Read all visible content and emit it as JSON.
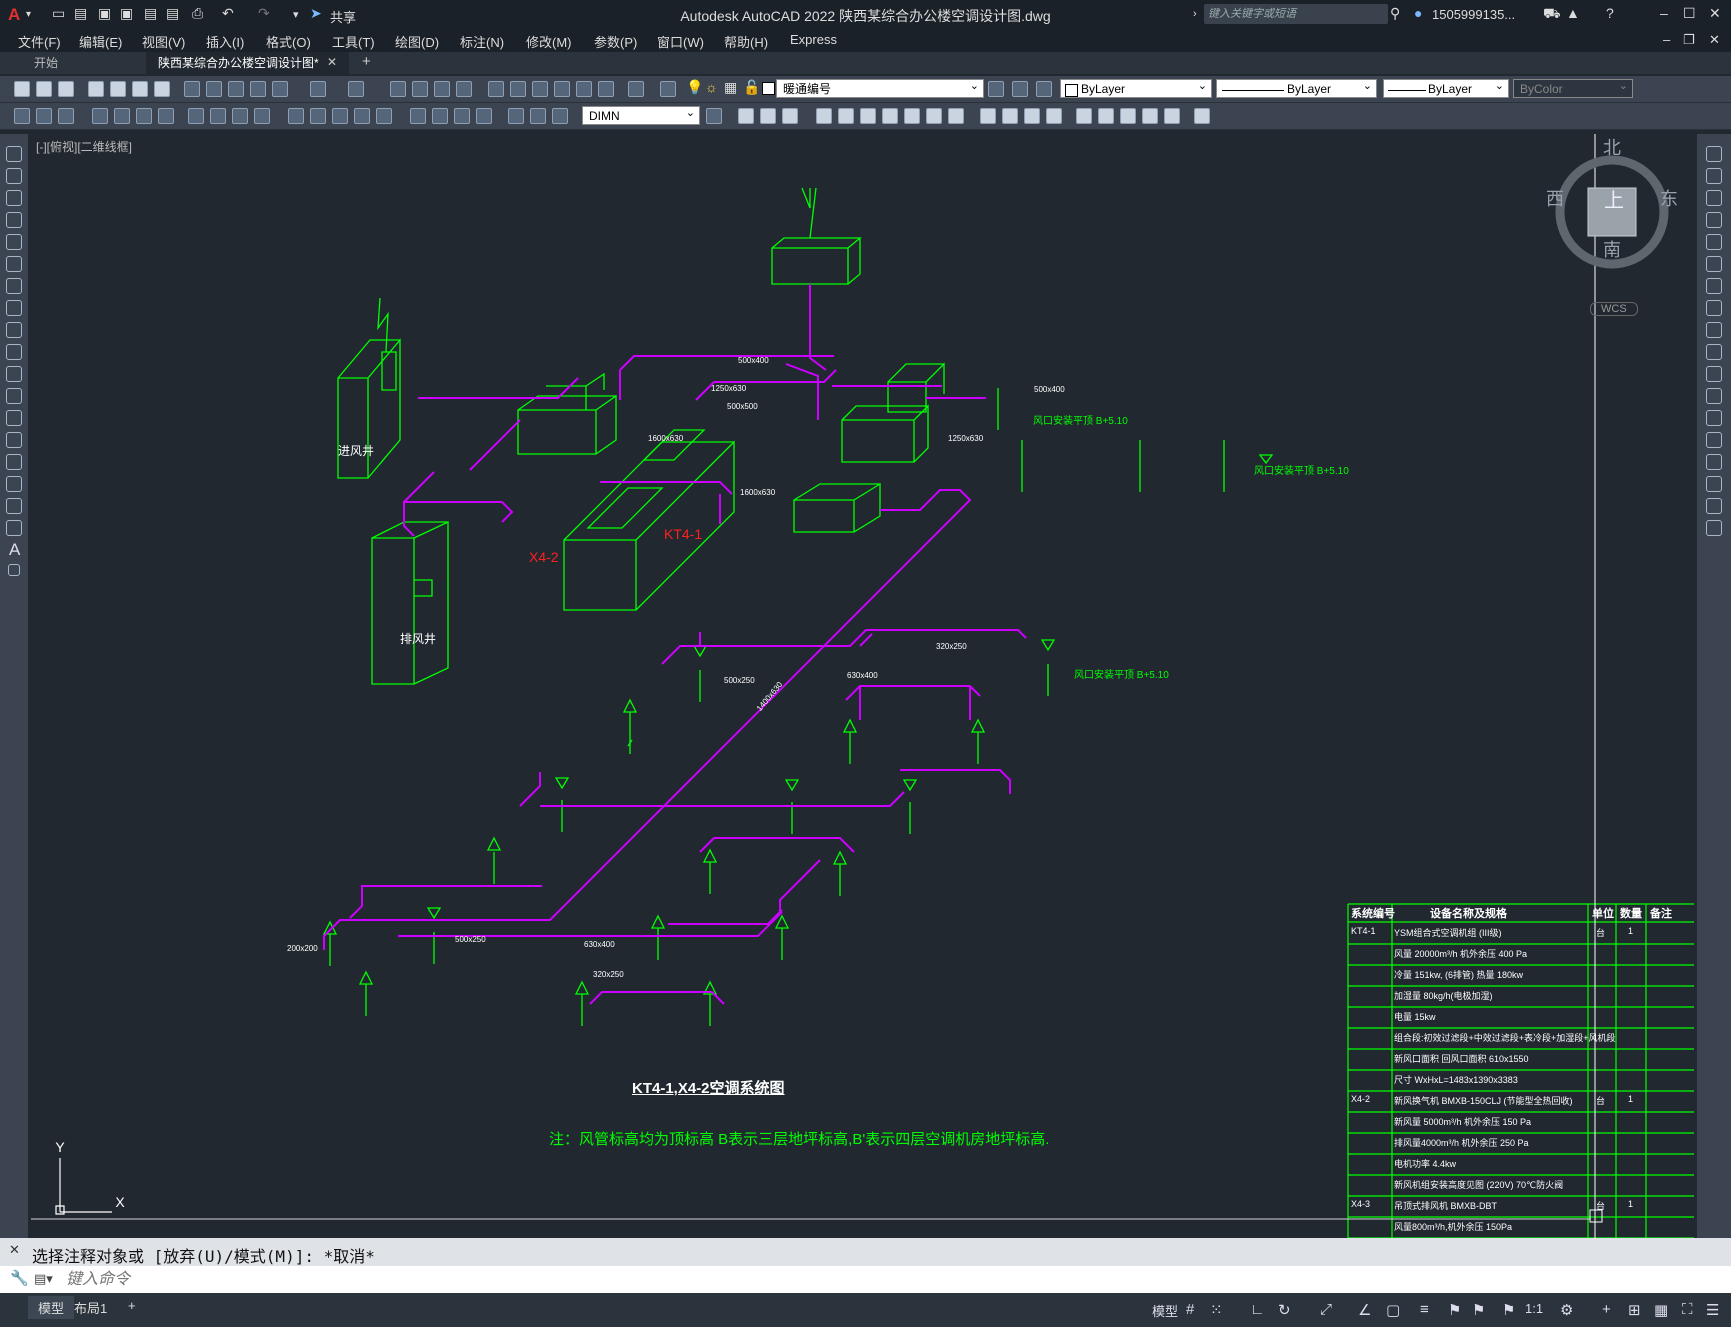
{
  "app": {
    "title": "Autodesk AutoCAD 2022    陕西某综合办公楼空调设计图.dwg",
    "share": "共享",
    "search_placeholder": "键入关键字或短语",
    "user": "1505999135..."
  },
  "menu": [
    "文件(F)",
    "编辑(E)",
    "视图(V)",
    "插入(I)",
    "格式(O)",
    "工具(T)",
    "绘图(D)",
    "标注(N)",
    "修改(M)",
    "参数(P)",
    "窗口(W)",
    "帮助(H)",
    "Express"
  ],
  "tabs": {
    "start": "开始",
    "file": "陕西某综合办公楼空调设计图*",
    "add": "+"
  },
  "toolbar": {
    "layer": "暖通编号",
    "color": "ByLayer",
    "linetype": "ByLayer",
    "lineweight": "ByLayer",
    "plotstyle": "ByColor",
    "dimstyle": "DIMN"
  },
  "viewport": {
    "label": "[-][俯视][二维线框]",
    "compass": {
      "n": "北",
      "s": "南",
      "e": "东",
      "w": "西",
      "center": "上",
      "wcs": "WCS"
    }
  },
  "drawing": {
    "title": "KT4-1,X4-2空调系统图",
    "note": "注：风管标高均为顶标高  B表示三层地坪标高,B'表示四层空调机房地坪标高.",
    "units": {
      "kt41": "KT4-1",
      "x42": "X4-2",
      "fresh_shaft": "进风井",
      "exhaust_shaft": "排风井"
    },
    "elev_right_1": "风口安装平顶 B+5.10",
    "elev_right_2": "风口安装平顶 B+5.10",
    "elev_right_3": "风口安装平顶 B+5.10",
    "duct_sizes": [
      "500x400",
      "1250x630",
      "500x500",
      "1600x630",
      "1250x630",
      "500x400",
      "1600x630",
      "1400x630",
      "630x400",
      "500x250",
      "320x250",
      "630x400",
      "500x250",
      "200x200",
      "320x250"
    ]
  },
  "table": {
    "headers": [
      "系统编号",
      "设备名称及规格",
      "单位",
      "数量",
      "备注"
    ],
    "rows": [
      {
        "id": "KT4-1",
        "spec": "YSM组合式空调机组 (III级)",
        "unit": "台",
        "qty": "1"
      },
      {
        "id": "",
        "spec": "风量 20000m³/h       机外余压 400 Pa",
        "unit": "",
        "qty": ""
      },
      {
        "id": "",
        "spec": "冷量  151kw, (6排管)        热量  180kw",
        "unit": "",
        "qty": ""
      },
      {
        "id": "",
        "spec": "加湿量 80kg/h(电极加湿)",
        "unit": "",
        "qty": ""
      },
      {
        "id": "",
        "spec": "电量 15kw",
        "unit": "",
        "qty": ""
      },
      {
        "id": "",
        "spec": "组合段:初效过滤段+中效过滤段+表冷段+加湿段+风机段",
        "unit": "",
        "qty": ""
      },
      {
        "id": "",
        "spec": "新风口面积   回风口面积   610x1550",
        "unit": "",
        "qty": ""
      },
      {
        "id": "",
        "spec": "尺寸 WxHxL=1483x1390x3383",
        "unit": "",
        "qty": ""
      },
      {
        "id": "X4-2",
        "spec": "新风换气机 BMXB-150CLJ   (节能型全热回收)",
        "unit": "台",
        "qty": "1"
      },
      {
        "id": "",
        "spec": "新风量 5000m³/h       机外余压 150 Pa",
        "unit": "",
        "qty": ""
      },
      {
        "id": "",
        "spec": "排风量4000m³/h       机外余压 250 Pa",
        "unit": "",
        "qty": ""
      },
      {
        "id": "",
        "spec": "电机功率 4.4kw",
        "unit": "",
        "qty": ""
      },
      {
        "id": "",
        "spec": "新风机组安装高度见图 (220V) 70℃防火阀",
        "unit": "",
        "qty": ""
      },
      {
        "id": "X4-3",
        "spec": "吊顶式排风机 BMXB-DBT",
        "unit": "台",
        "qty": "1"
      },
      {
        "id": "",
        "spec": "风量800m³/h,机外余压 150Pa",
        "unit": "",
        "qty": ""
      }
    ]
  },
  "command": {
    "history": "选择注释对象或 [放弃(U)/模式(M)]: *取消*",
    "placeholder": "键入命令"
  },
  "status": {
    "model": "模型",
    "layout1": "布局1",
    "add": "+",
    "model_btn": "模型",
    "scale": "1:1"
  },
  "colors": {
    "duct": "#cc00ff",
    "equip": "#00ff00",
    "label_red": "#ff2020",
    "bg": "#212830"
  }
}
